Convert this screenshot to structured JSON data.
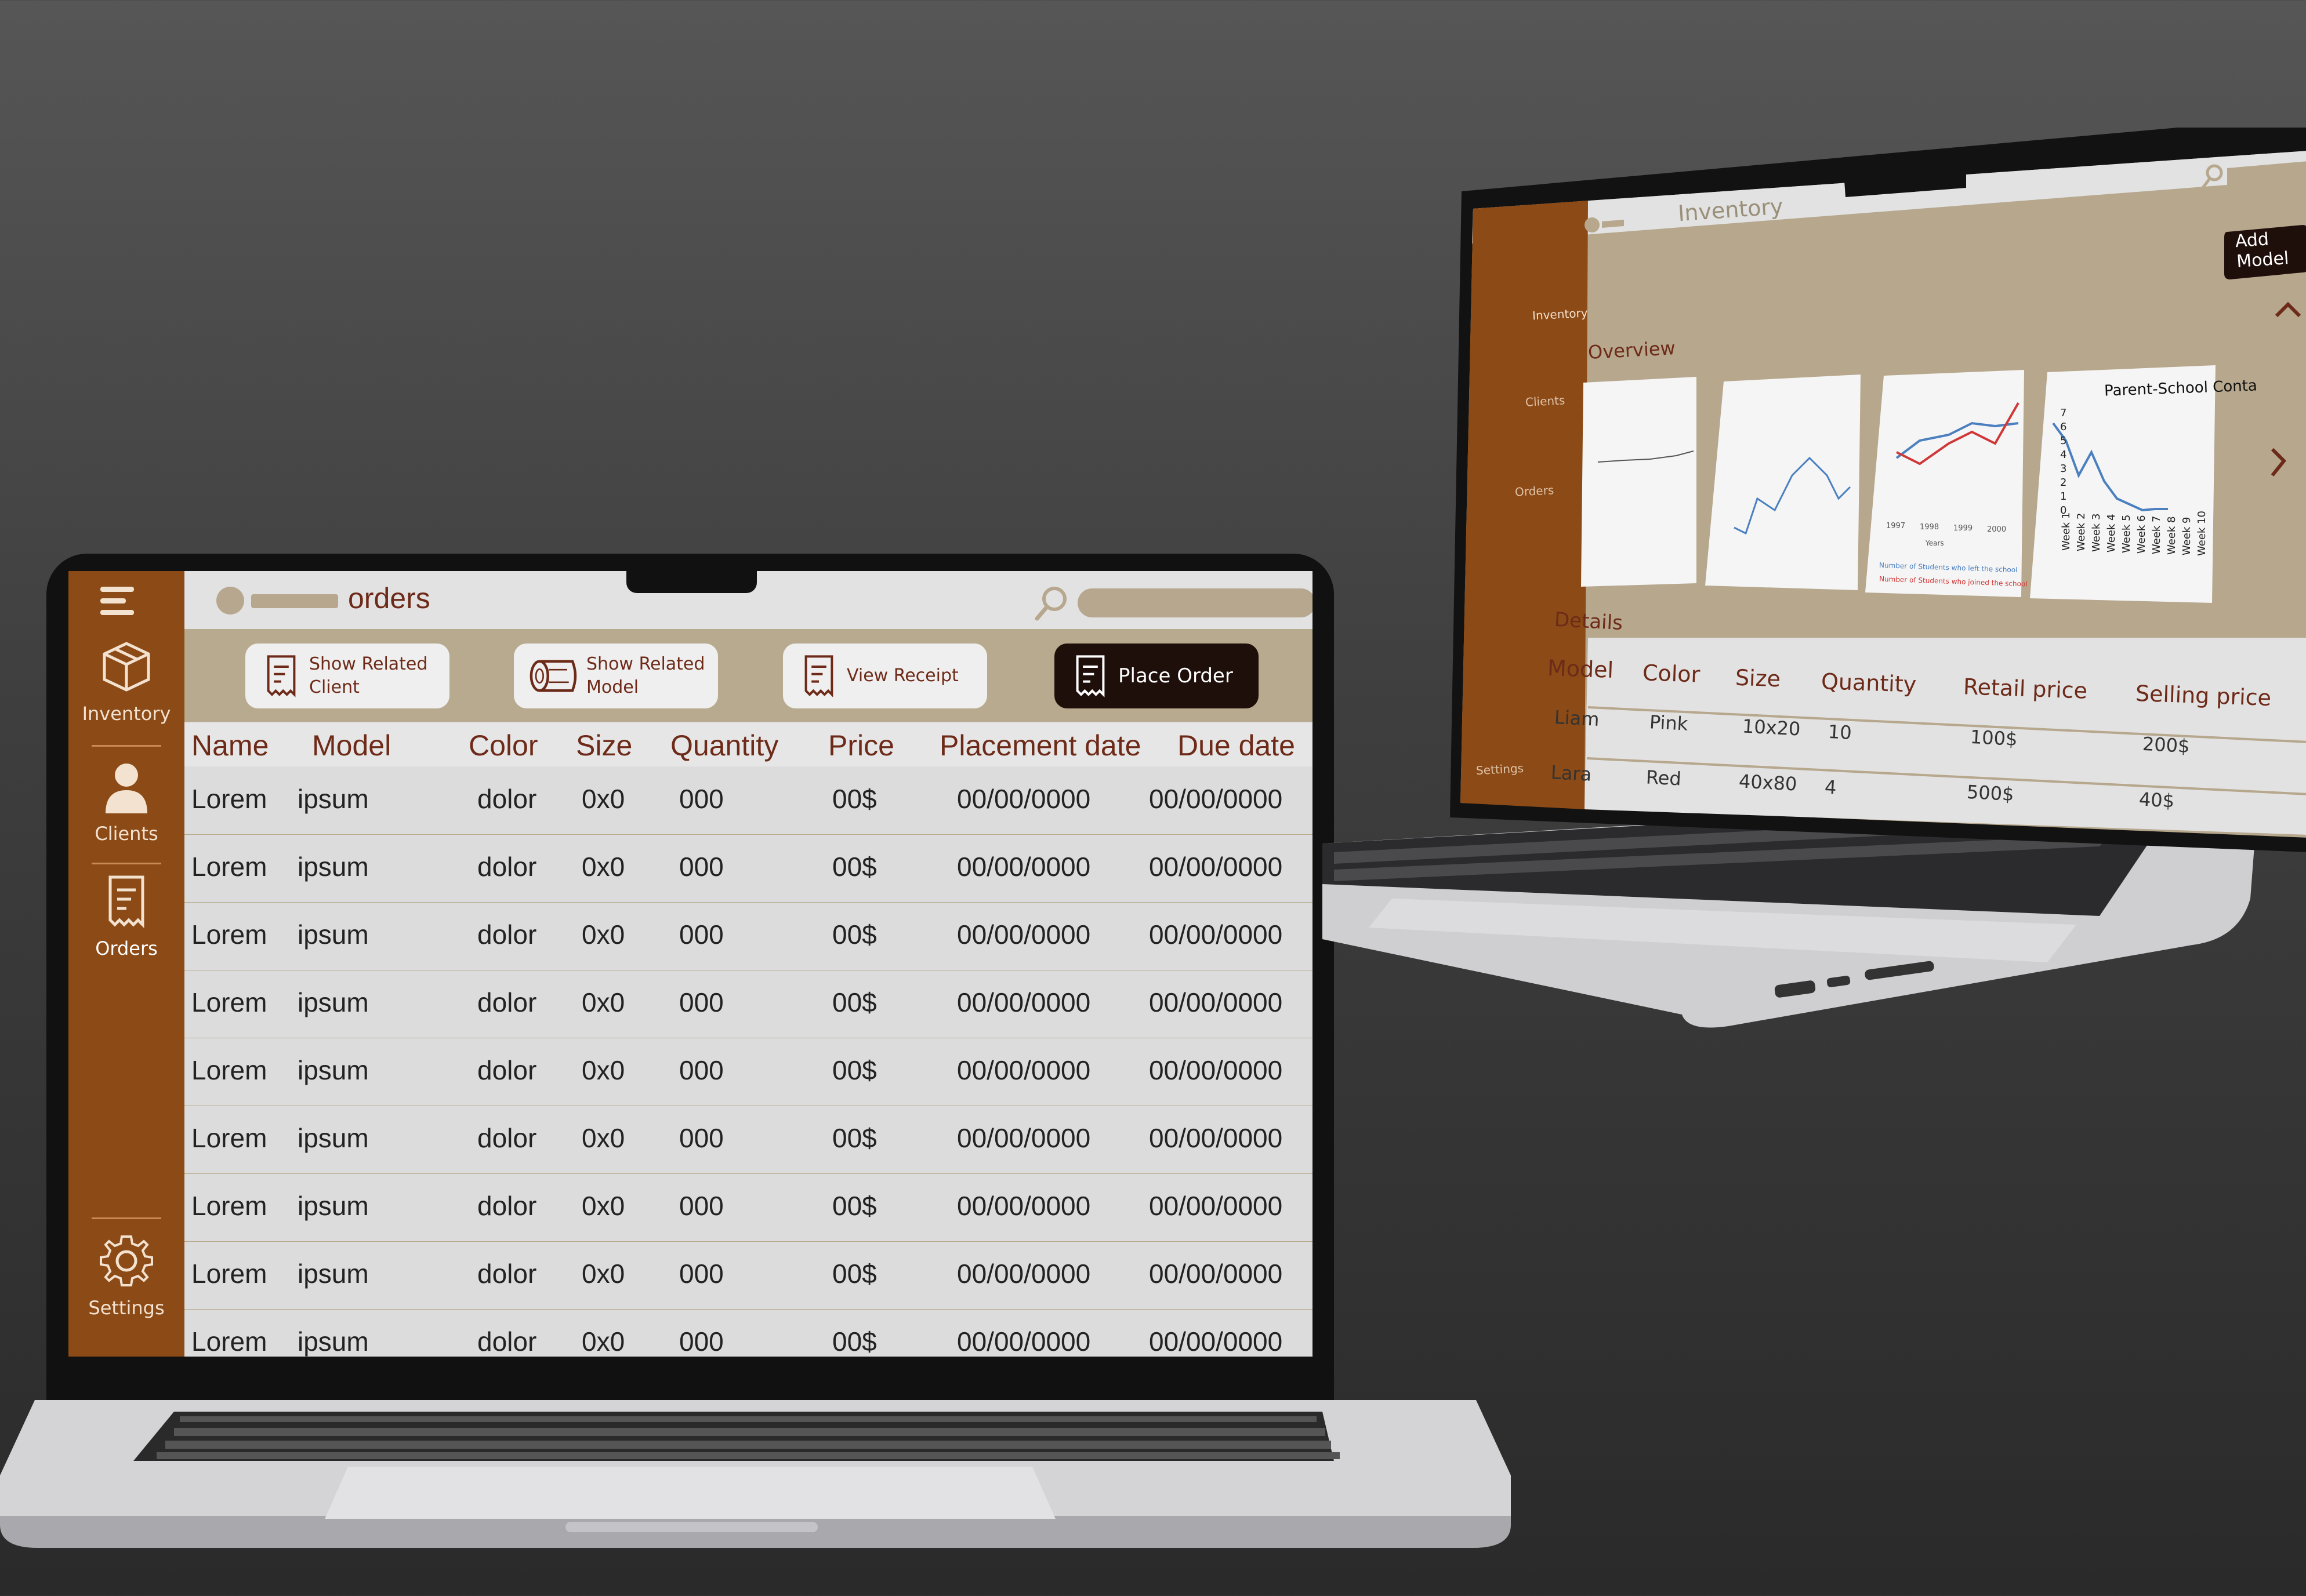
{
  "colors": {
    "sidebar": "#8b4a16",
    "accent_text": "#6d2a18",
    "band": "#b7aa8e",
    "dark_button": "#1e0f0b"
  },
  "laptop1": {
    "title": "orders",
    "sidebar": {
      "items": [
        {
          "label": "Inventory",
          "icon": "box-icon"
        },
        {
          "label": "Clients",
          "icon": "person-icon"
        },
        {
          "label": "Orders",
          "icon": "receipt-icon"
        }
      ],
      "settings": {
        "label": "Settings",
        "icon": "gear-icon"
      }
    },
    "actions": [
      {
        "label": "Show Related Client",
        "icon": "receipt-icon"
      },
      {
        "label": "Show Related Model",
        "icon": "log-icon"
      },
      {
        "label": "View Receipt",
        "icon": "receipt-icon"
      },
      {
        "label": "Place Order",
        "icon": "receipt-icon"
      }
    ],
    "columns": [
      "Name",
      "Model",
      "Color",
      "Size",
      "Quantity",
      "Price",
      "Placement date",
      "Due date"
    ],
    "rows": [
      [
        "Lorem",
        "ipsum",
        "dolor",
        "0x0",
        "000",
        "00$",
        "00/00/0000",
        "00/00/0000"
      ],
      [
        "Lorem",
        "ipsum",
        "dolor",
        "0x0",
        "000",
        "00$",
        "00/00/0000",
        "00/00/0000"
      ],
      [
        "Lorem",
        "ipsum",
        "dolor",
        "0x0",
        "000",
        "00$",
        "00/00/0000",
        "00/00/0000"
      ],
      [
        "Lorem",
        "ipsum",
        "dolor",
        "0x0",
        "000",
        "00$",
        "00/00/0000",
        "00/00/0000"
      ],
      [
        "Lorem",
        "ipsum",
        "dolor",
        "0x0",
        "000",
        "00$",
        "00/00/0000",
        "00/00/0000"
      ],
      [
        "Lorem",
        "ipsum",
        "dolor",
        "0x0",
        "000",
        "00$",
        "00/00/0000",
        "00/00/0000"
      ],
      [
        "Lorem",
        "ipsum",
        "dolor",
        "0x0",
        "000",
        "00$",
        "00/00/0000",
        "00/00/0000"
      ],
      [
        "Lorem",
        "ipsum",
        "dolor",
        "0x0",
        "000",
        "00$",
        "00/00/0000",
        "00/00/0000"
      ],
      [
        "Lorem",
        "ipsum",
        "dolor",
        "0x0",
        "000",
        "00$",
        "00/00/0000",
        "00/00/0000"
      ]
    ]
  },
  "laptop2": {
    "title": "Inventory",
    "add_button": "Add Model",
    "overview_label": "Overview",
    "details_label": "Details",
    "chart4_title": "Parent-School Conta",
    "chart4_xticks": [
      "Week 1",
      "Week 2",
      "Week 3",
      "Week 4",
      "Week 5",
      "Week 6",
      "Week 7",
      "Week 8",
      "Week 9",
      "Week 10"
    ],
    "chart4_yticks": [
      "0",
      "1",
      "2",
      "3",
      "4",
      "5",
      "6",
      "7"
    ],
    "chart3_xticks": [
      "1997",
      "1998",
      "1999",
      "2000"
    ],
    "chart3_xlabel": "Years",
    "chart3_legend": [
      "Number of Students who left the school",
      "Number of Students who joined the school"
    ],
    "sidebar": {
      "items": [
        {
          "label": "Inventory",
          "icon": "box-icon"
        },
        {
          "label": "Clients",
          "icon": "person-icon"
        },
        {
          "label": "Orders",
          "icon": "receipt-icon"
        }
      ],
      "settings": {
        "label": "Settings",
        "icon": "gear-icon"
      }
    },
    "columns": [
      "Model",
      "Color",
      "Size",
      "Quantity",
      "Retail price",
      "Selling price"
    ],
    "rows": [
      [
        "Liam",
        "Pink",
        "10x20",
        "10",
        "100$",
        "200$"
      ],
      [
        "Lara",
        "Red",
        "40x80",
        "4",
        "500$",
        "40$"
      ]
    ]
  }
}
